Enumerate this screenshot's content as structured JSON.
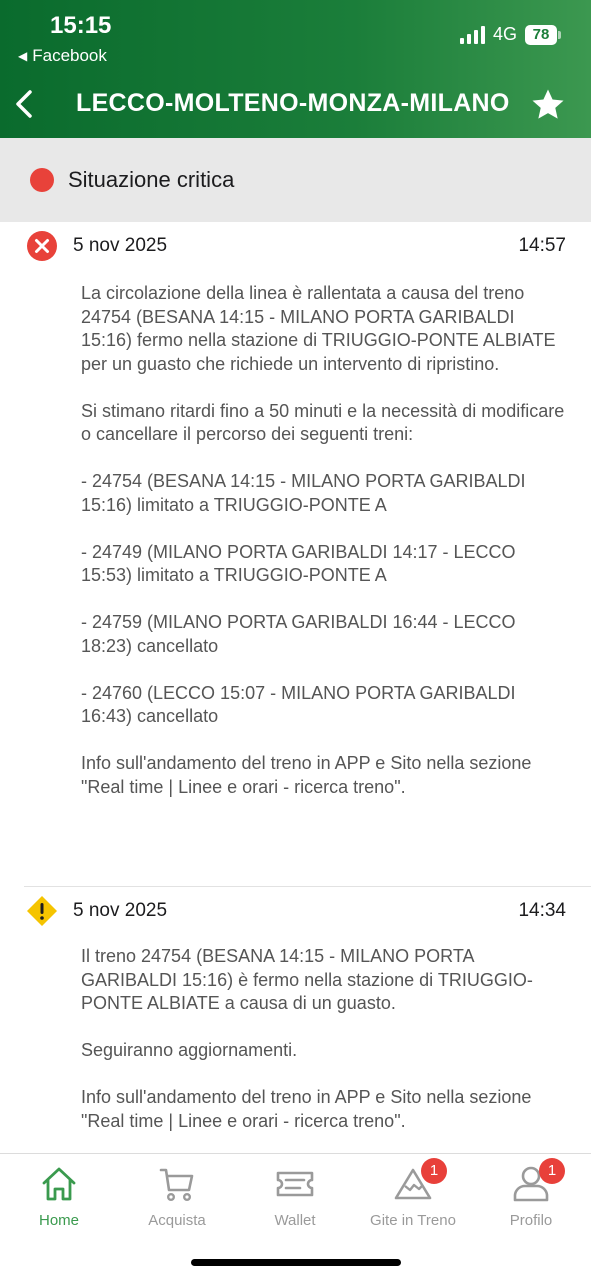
{
  "status_bar": {
    "time": "15:15",
    "back_app": "Facebook",
    "network": "4G",
    "battery": "78"
  },
  "header": {
    "title": "LECCO-MOLTENO-MONZA-MILANO",
    "accent_color": "#1b7e3a"
  },
  "severity": {
    "label": "Situazione critica",
    "color": "#e8423a"
  },
  "messages": [
    {
      "icon": "error-circle-icon",
      "date": "5 nov 2025",
      "time": "14:57",
      "paragraphs": [
        "La circolazione della linea è rallentata a causa del treno 24754 (BESANA 14:15 - MILANO PORTA GARIBALDI 15:16) fermo nella stazione di TRIUGGIO-PONTE ALBIATE per un guasto che richiede un intervento di ripristino.",
        "Si stimano ritardi fino a 50 minuti e la necessità di modificare o cancellare il percorso dei seguenti treni:",
        "- 24754 (BESANA 14:15 - MILANO PORTA GARIBALDI 15:16) limitato a TRIUGGIO-PONTE A",
        "- 24749 (MILANO PORTA GARIBALDI 14:17 - LECCO 15:53) limitato a TRIUGGIO-PONTE A",
        "- 24759 (MILANO PORTA GARIBALDI 16:44 - LECCO 18:23) cancellato",
        "- 24760 (LECCO 15:07 - MILANO PORTA GARIBALDI 16:43) cancellato",
        "Info sull'andamento del treno in APP e Sito nella sezione \"Real time | Linee e orari - ricerca treno\"."
      ]
    },
    {
      "icon": "warning-diamond-icon",
      "date": "5 nov 2025",
      "time": "14:34",
      "paragraphs": [
        "Il treno 24754 (BESANA 14:15 - MILANO PORTA GARIBALDI 15:16) è fermo nella stazione di TRIUGGIO-PONTE ALBIATE a causa di un guasto.",
        "Seguiranno aggiornamenti.",
        "Info sull'andamento del treno in APP e Sito nella sezione \"Real time | Linee e orari - ricerca treno\"."
      ]
    }
  ],
  "tabbar": {
    "active_color": "#3a9a4e",
    "items": [
      {
        "label": "Home",
        "icon": "home-icon",
        "badge": ""
      },
      {
        "label": "Acquista",
        "icon": "cart-icon",
        "badge": ""
      },
      {
        "label": "Wallet",
        "icon": "ticket-icon",
        "badge": ""
      },
      {
        "label": "Gite in Treno",
        "icon": "mountain-icon",
        "badge": "1"
      },
      {
        "label": "Profilo",
        "icon": "profile-icon",
        "badge": "1"
      }
    ]
  }
}
